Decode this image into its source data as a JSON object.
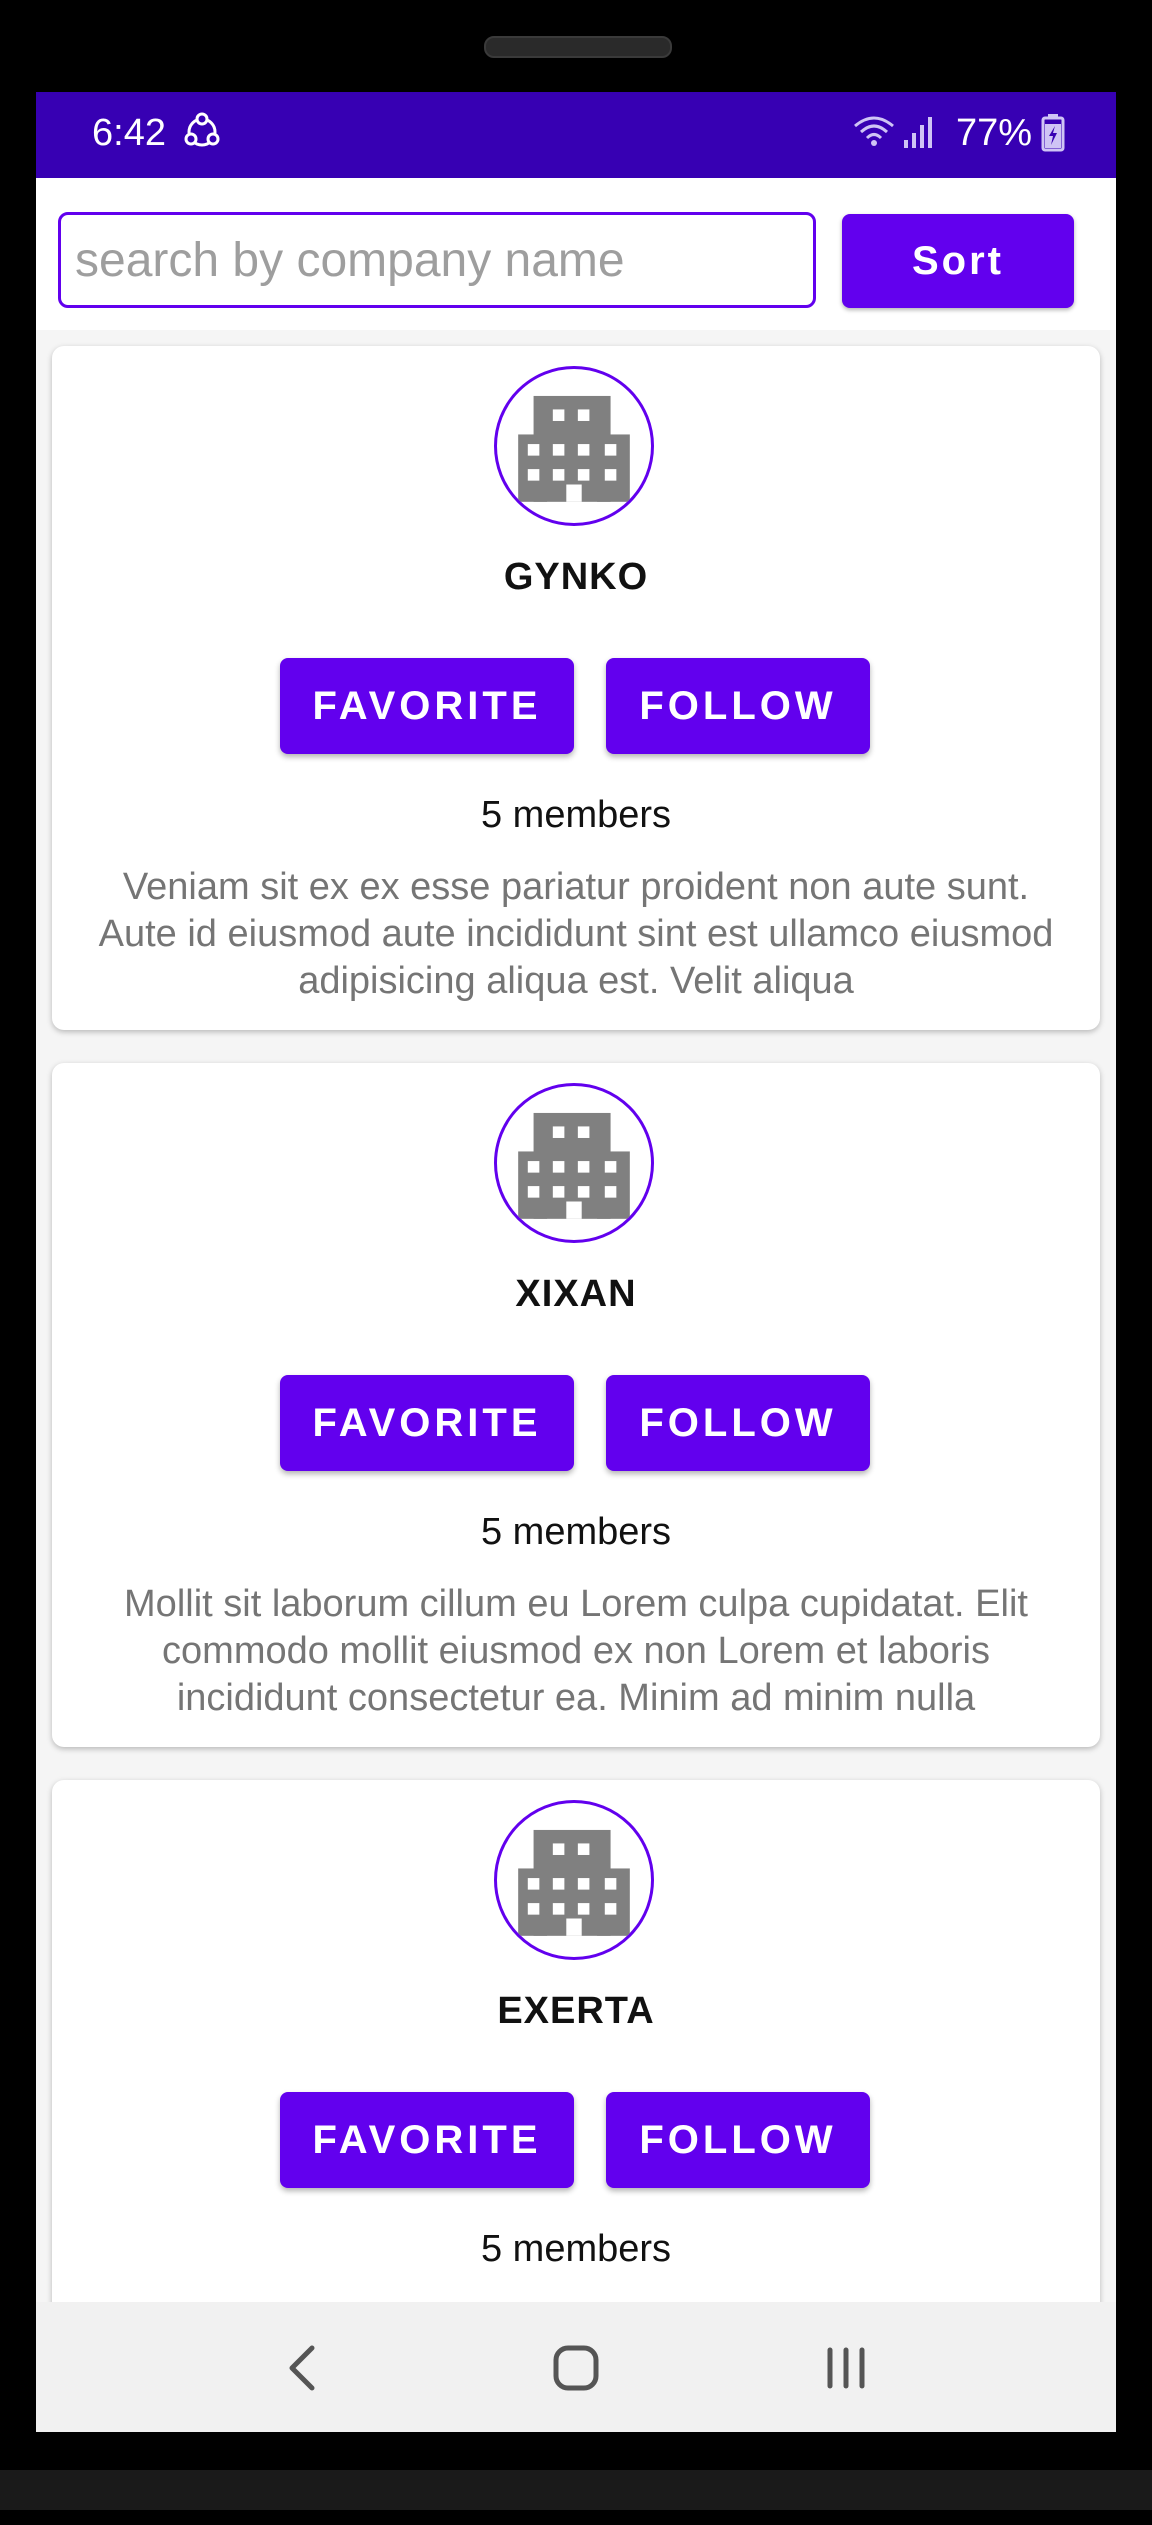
{
  "status_bar": {
    "time": "6:42",
    "battery": "77%",
    "icons": [
      "sync-icon",
      "wifi-icon",
      "signal-icon",
      "battery-icon"
    ]
  },
  "search": {
    "placeholder": "search by company name",
    "value": ""
  },
  "sort_label": "Sort",
  "companies": [
    {
      "name": "GYNKO",
      "favorite_label": "FAVORITE",
      "follow_label": "FOLLOW",
      "members": "5 members",
      "description": "Veniam sit ex ex esse pariatur proident non aute sunt. Aute id eiusmod aute incididunt sint est ullamco eiusmod adipisicing aliqua est. Velit aliqua"
    },
    {
      "name": "XIXAN",
      "favorite_label": "FAVORITE",
      "follow_label": "FOLLOW",
      "members": "5 members",
      "description": "Mollit sit laborum cillum eu Lorem culpa cupidatat. Elit commodo mollit eiusmod ex non Lorem et laboris incididunt consectetur ea. Minim ad minim nulla"
    },
    {
      "name": "EXERTA",
      "favorite_label": "FAVORITE",
      "follow_label": "FOLLOW",
      "members": "5 members",
      "description": ""
    }
  ],
  "colors": {
    "primary": "#6200ee",
    "status_bar": "#3700b3",
    "logo_gray": "#808080",
    "description_text": "#757575"
  },
  "nav_bar": {
    "icons": [
      "back-icon",
      "home-icon",
      "recents-icon"
    ]
  }
}
